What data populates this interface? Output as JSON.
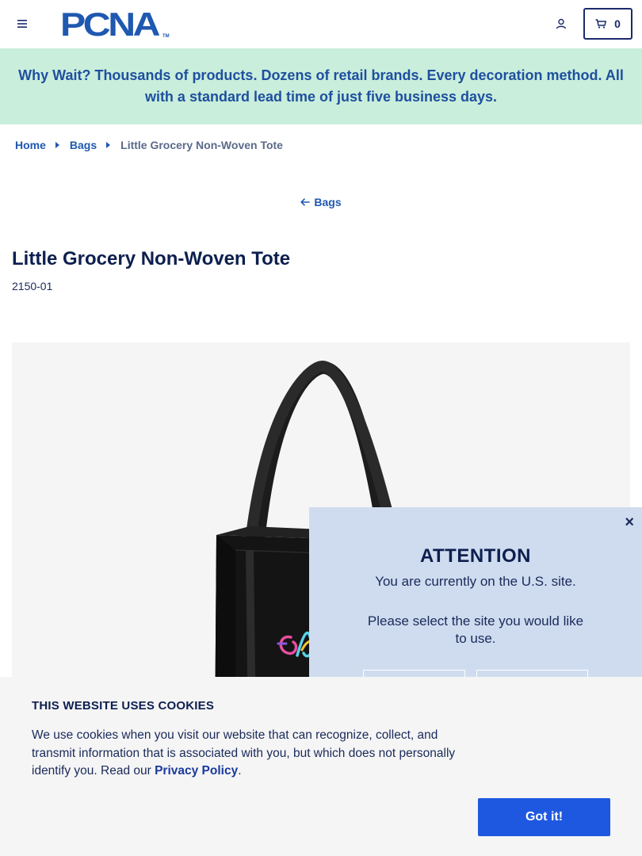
{
  "header": {
    "logo_text": "PCNA",
    "logo_tm": "TM",
    "cart_count": "0",
    "icons": {
      "menu": "hamburger-icon",
      "account": "user-icon",
      "cart": "cart-icon"
    }
  },
  "promo": {
    "text": "Why Wait? Thousands of products. Dozens of retail brands. Every decoration method. All with a standard lead time of just five business days."
  },
  "breadcrumb": {
    "items": [
      {
        "label": "Home"
      },
      {
        "label": "Bags"
      }
    ],
    "current": "Little Grocery Non-Woven Tote"
  },
  "back_link": {
    "label": "Bags"
  },
  "product": {
    "title": "Little Grocery Non-Woven Tote",
    "sku": "2150-01"
  },
  "attention": {
    "title": "ATTENTION",
    "line1": "You are currently on the U.S. site.",
    "line2": "Please select the site you would like to use.",
    "close": "×"
  },
  "cookies": {
    "title": "THIS WEBSITE USES COOKIES",
    "body": "We use cookies when you visit our website that can recognize, collect, and transmit information that is associated with you, but which does not personally identify you. Read our ",
    "link": "Privacy Policy",
    "period": ".",
    "button": "Got it!"
  },
  "colors": {
    "brand_blue": "#1f58b0",
    "navy": "#0d1f4f",
    "promo_bg": "#c9eedb",
    "modal_bg": "#cfdcef",
    "button_blue": "#1f58e0"
  }
}
